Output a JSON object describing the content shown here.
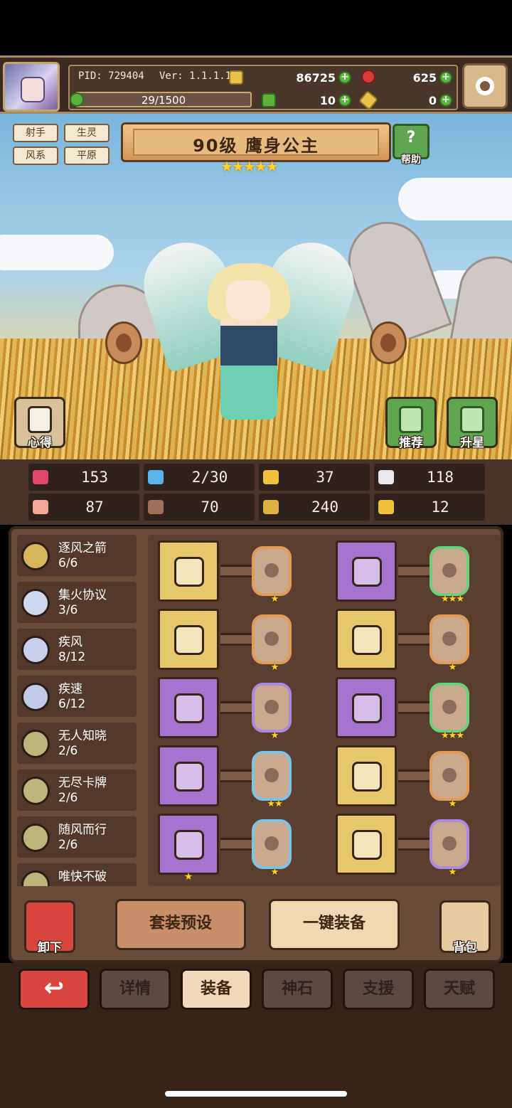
{
  "header": {
    "pid": "PID: 729404",
    "version": "Ver: 1.1.1.14",
    "gold": "86725",
    "gems": "625",
    "stamina": "29/1500",
    "stamina_fraction": 0.019,
    "clover": "10",
    "keys": "0"
  },
  "hero": {
    "tags": [
      "射手",
      "生灵",
      "风系",
      "平原"
    ],
    "title": "90级  鹰身公主",
    "stars": "★★★★★",
    "help_label": "帮助",
    "notes_label": "心得",
    "recommend_label": "推荐",
    "upgrade_label": "升星"
  },
  "stats": [
    {
      "icon": "heart-icon",
      "value": "153",
      "color": "#e0476a"
    },
    {
      "icon": "water-drop-icon",
      "value": "2/30",
      "color": "#5ab4ea"
    },
    {
      "icon": "shield-icon",
      "value": "37",
      "color": "#f0c23a"
    },
    {
      "icon": "wing-icon",
      "value": "118",
      "color": "#e8e8ee"
    },
    {
      "icon": "fist-icon",
      "value": "87",
      "color": "#f2a79a"
    },
    {
      "icon": "book-icon",
      "value": "70",
      "color": "#a0705a"
    },
    {
      "icon": "flag-icon",
      "value": "240",
      "color": "#e0b040"
    },
    {
      "icon": "horseshoe-icon",
      "value": "12",
      "color": "#f0c23a"
    }
  ],
  "sets": [
    {
      "name": "逐风之箭",
      "count": "6/6",
      "color": "#d8b45a"
    },
    {
      "name": "集火协议",
      "count": "3/6",
      "color": "#cfd8ee"
    },
    {
      "name": "疾风",
      "count": "8/12",
      "color": "#c8d0ee"
    },
    {
      "name": "疾速",
      "count": "6/12",
      "color": "#c4cbe8"
    },
    {
      "name": "无人知晓",
      "count": "2/6",
      "color": "#bdb67a"
    },
    {
      "name": "无尽卡牌",
      "count": "2/6",
      "color": "#bdb67a"
    },
    {
      "name": "随风而行",
      "count": "2/6",
      "color": "#bdb67a"
    },
    {
      "name": "唯快不破",
      "count": "",
      "color": "#bdb67a"
    }
  ],
  "equipment": [
    {
      "name": "bow-icon",
      "rarity": "gold",
      "stars": "",
      "slot": "orange",
      "slot_stars": "★"
    },
    {
      "name": "collar-icon",
      "rarity": "purple",
      "stars": "",
      "slot": "green",
      "slot_stars": "★★★"
    },
    {
      "name": "arrow-icon",
      "rarity": "gold",
      "stars": "",
      "slot": "orange",
      "slot_stars": "★"
    },
    {
      "name": "armor-icon",
      "rarity": "gold",
      "stars": "",
      "slot": "orange",
      "slot_stars": "★"
    },
    {
      "name": "necklace-icon",
      "rarity": "purple",
      "stars": "",
      "slot": "purple",
      "slot_stars": "★"
    },
    {
      "name": "boot-icon",
      "rarity": "purple",
      "stars": "",
      "slot": "green",
      "slot_stars": "★★★"
    },
    {
      "name": "gem-icon",
      "rarity": "purple",
      "stars": "",
      "slot": "blue",
      "slot_stars": "★★"
    },
    {
      "name": "ring-icon",
      "rarity": "gold",
      "stars": "",
      "slot": "orange",
      "slot_stars": "★"
    },
    {
      "name": "black-ring-icon",
      "rarity": "purple",
      "stars": "★",
      "slot": "blue",
      "slot_stars": "★"
    },
    {
      "name": "shoes-icon",
      "rarity": "gold",
      "stars": "",
      "slot": "purple",
      "slot_stars": "★"
    }
  ],
  "actions": {
    "unequip": "卸下",
    "preset": "套装预设",
    "auto_equip": "一键装备",
    "bag": "背包"
  },
  "tabs": {
    "details": "详情",
    "equipment": "装备",
    "stone": "神石",
    "support": "支援",
    "talent": "天赋"
  }
}
